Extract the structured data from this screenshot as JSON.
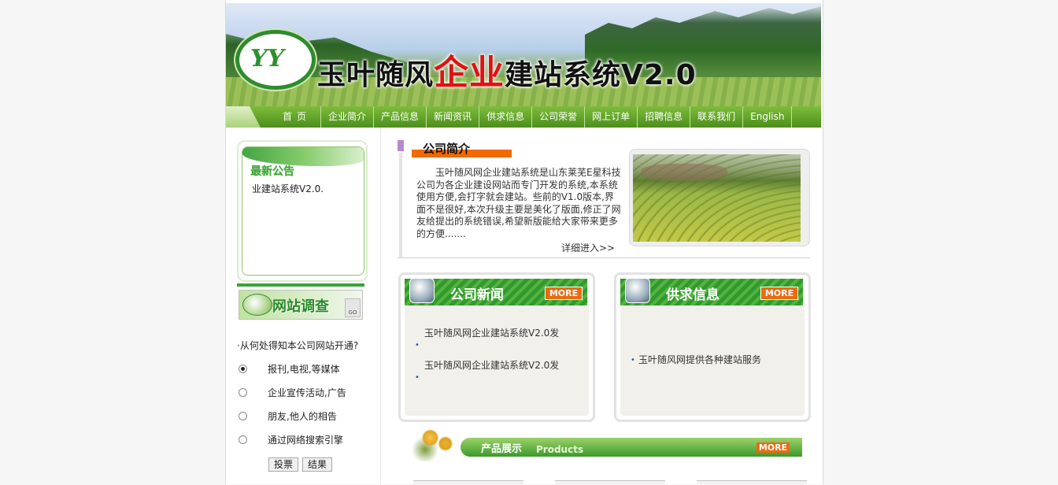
{
  "header": {
    "logo_text": "YY",
    "title_part1": "玉叶随风",
    "title_part2": "企业",
    "title_part3": "建站系统V2.0"
  },
  "nav": {
    "items": [
      "首页",
      "企业简介",
      "产品信息",
      "新闻资讯",
      "供求信息",
      "公司荣誉",
      "网上订单",
      "招聘信息",
      "联系我们",
      "English"
    ]
  },
  "notice": {
    "title": "最新公告",
    "text": "业建站系统V2.0."
  },
  "survey": {
    "title": "网站调查",
    "go_label": "GO",
    "question": "·从何处得知本公司网站开通?",
    "options": [
      "报刊,电视,等媒体",
      "企业宣传活动,广告",
      "朋友,他人的相告",
      "通过网络搜索引擎"
    ],
    "selected": 0,
    "vote_label": "投票",
    "result_label": "结果"
  },
  "about": {
    "title": "公司简介",
    "text": "玉叶随风网企业建站系统是山东莱芜E星科技公司为各企业建设网站而专门开发的系统,本系统使用方便,会打字就会建站。些前的V1.0版本,界面不是很好,本次升级主要是美化了版面,修正了网友给提出的系统错误,希望新版能给大家带来更多的方便.......",
    "more_label": "详细进入>>"
  },
  "news": {
    "title": "公司新闻",
    "more_label": "MORE",
    "items": [
      "玉叶随风网企业建站系统V2.0发",
      "玉叶随风网企业建站系统V2.0发"
    ]
  },
  "supply": {
    "title": "供求信息",
    "more_label": "MORE",
    "items": [
      "玉叶随风网提供各种建站服务"
    ]
  },
  "products": {
    "title": "产品展示",
    "subtitle": "Products",
    "more_label": "MORE"
  }
}
